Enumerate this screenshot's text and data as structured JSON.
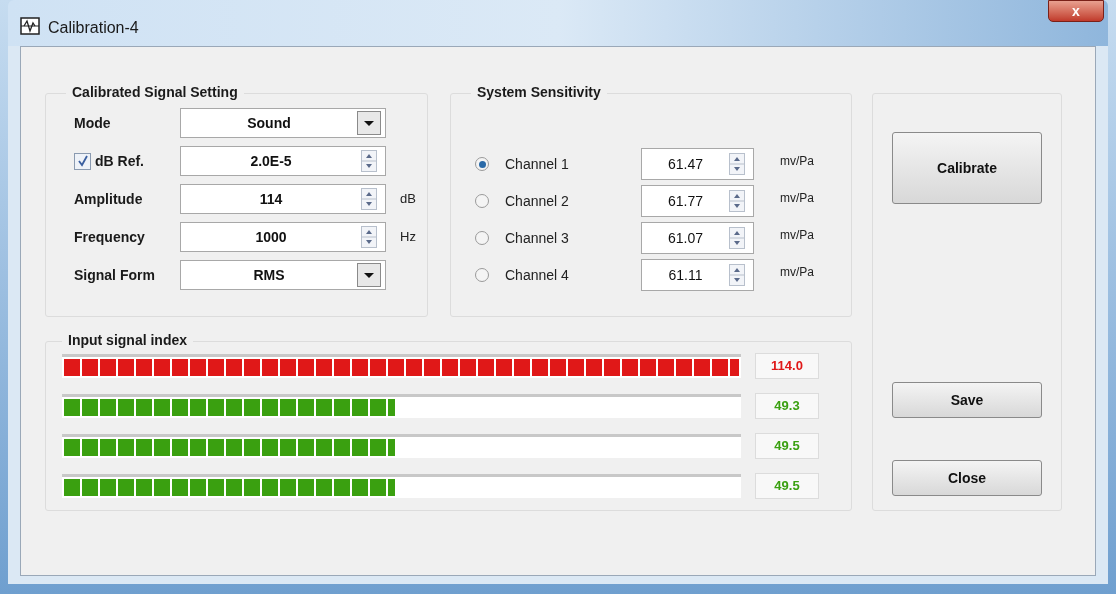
{
  "window": {
    "title": "Calibration-4",
    "close": "x"
  },
  "signal_setting": {
    "title": "Calibrated Signal Setting",
    "rows": [
      {
        "kind": "dropdown",
        "label": "Mode",
        "value": "Sound"
      },
      {
        "kind": "checkspin",
        "label": "dB Ref.",
        "checked": true,
        "value": "2.0E-5"
      },
      {
        "kind": "spin",
        "label": "Amplitude",
        "value": "114",
        "unit": "dB"
      },
      {
        "kind": "spin",
        "label": "Frequency",
        "value": "1000",
        "unit": "Hz"
      },
      {
        "kind": "dropdown",
        "label": "Signal Form",
        "value": "RMS"
      }
    ]
  },
  "sensitivity": {
    "title": "System Sensitivity",
    "channels": [
      {
        "label": "Channel 1",
        "selected": true,
        "value": "61.47",
        "unit": "mv/Pa"
      },
      {
        "label": "Channel 2",
        "selected": false,
        "value": "61.77",
        "unit": "mv/Pa"
      },
      {
        "label": "Channel 3",
        "selected": false,
        "value": "61.07",
        "unit": "mv/Pa"
      },
      {
        "label": "Channel 4",
        "selected": false,
        "value": "61.11",
        "unit": "mv/Pa"
      }
    ]
  },
  "input_signal": {
    "title": "Input signal index",
    "meters": [
      {
        "level": 1.0,
        "color": "#e01818",
        "reading": "114.0"
      },
      {
        "level": 0.49,
        "color": "#3aa010",
        "reading": "49.3"
      },
      {
        "level": 0.49,
        "color": "#3aa010",
        "reading": "49.5"
      },
      {
        "level": 0.49,
        "color": "#3aa010",
        "reading": "49.5"
      }
    ]
  },
  "buttons": {
    "calibrate": "Calibrate",
    "save": "Save",
    "close": "Close"
  }
}
